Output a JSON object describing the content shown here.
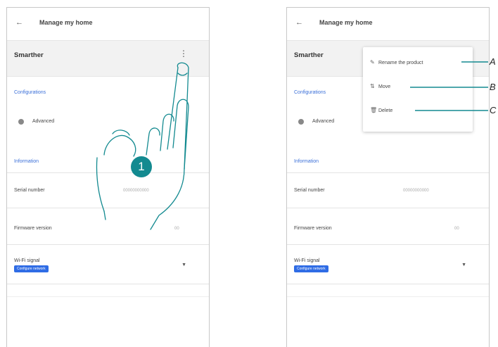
{
  "header": {
    "back_icon": "arrow-left-icon",
    "title": "Manage my home"
  },
  "product": {
    "name": "Smarther",
    "menu_icon": "kebab-menu-icon"
  },
  "sections": {
    "configurations": "Configurations",
    "advanced": "Advanced",
    "information": "Information",
    "serial_label": "Serial number",
    "serial_value": "00000000000",
    "firmware_label": "Firmware version",
    "firmware_value": "00",
    "wifi_label": "Wi-Fi signal",
    "wifi_badge": "Configure network"
  },
  "menu": {
    "items": [
      {
        "icon": "pencil-icon",
        "label": "Rename the product"
      },
      {
        "icon": "move-icon",
        "label": "Move"
      },
      {
        "icon": "trash-icon",
        "label": "Delete"
      }
    ]
  },
  "callouts": {
    "a": "A",
    "b": "B",
    "c": "C",
    "step": "1"
  },
  "colors": {
    "accent": "#138a90",
    "link": "#3a6fd8",
    "badge": "#2f6ce5"
  }
}
